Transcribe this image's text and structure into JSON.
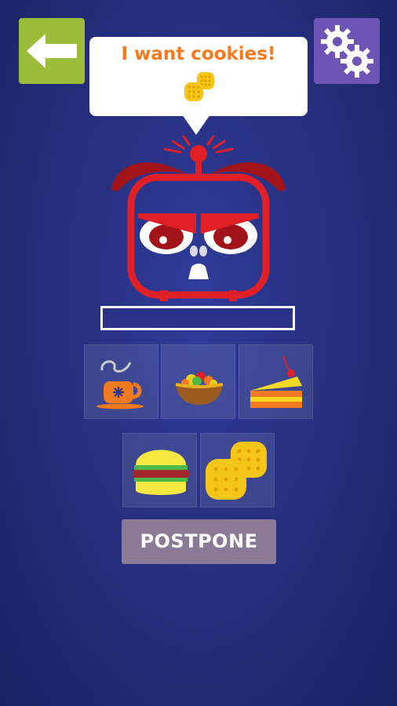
{
  "bubble": {
    "text": "I want cookies!",
    "icon": "cookies-icon"
  },
  "progress": {
    "value": 0
  },
  "header": {
    "back_icon": "back-arrow-icon",
    "settings_icon": "gears-icon"
  },
  "food_items": [
    {
      "name": "coffee",
      "icon": "coffee-cup-icon"
    },
    {
      "name": "salad",
      "icon": "salad-bowl-icon"
    },
    {
      "name": "cake",
      "icon": "cake-slice-icon"
    },
    {
      "name": "burger",
      "icon": "burger-icon"
    },
    {
      "name": "cookies",
      "icon": "cookies-icon"
    }
  ],
  "actions": {
    "postpone_label": "POSTPONE"
  },
  "colors": {
    "accent_orange": "#f47a20",
    "robot_red": "#e11f26",
    "back_green": "#9bbd3a",
    "settings_purple": "#6e55b5"
  }
}
